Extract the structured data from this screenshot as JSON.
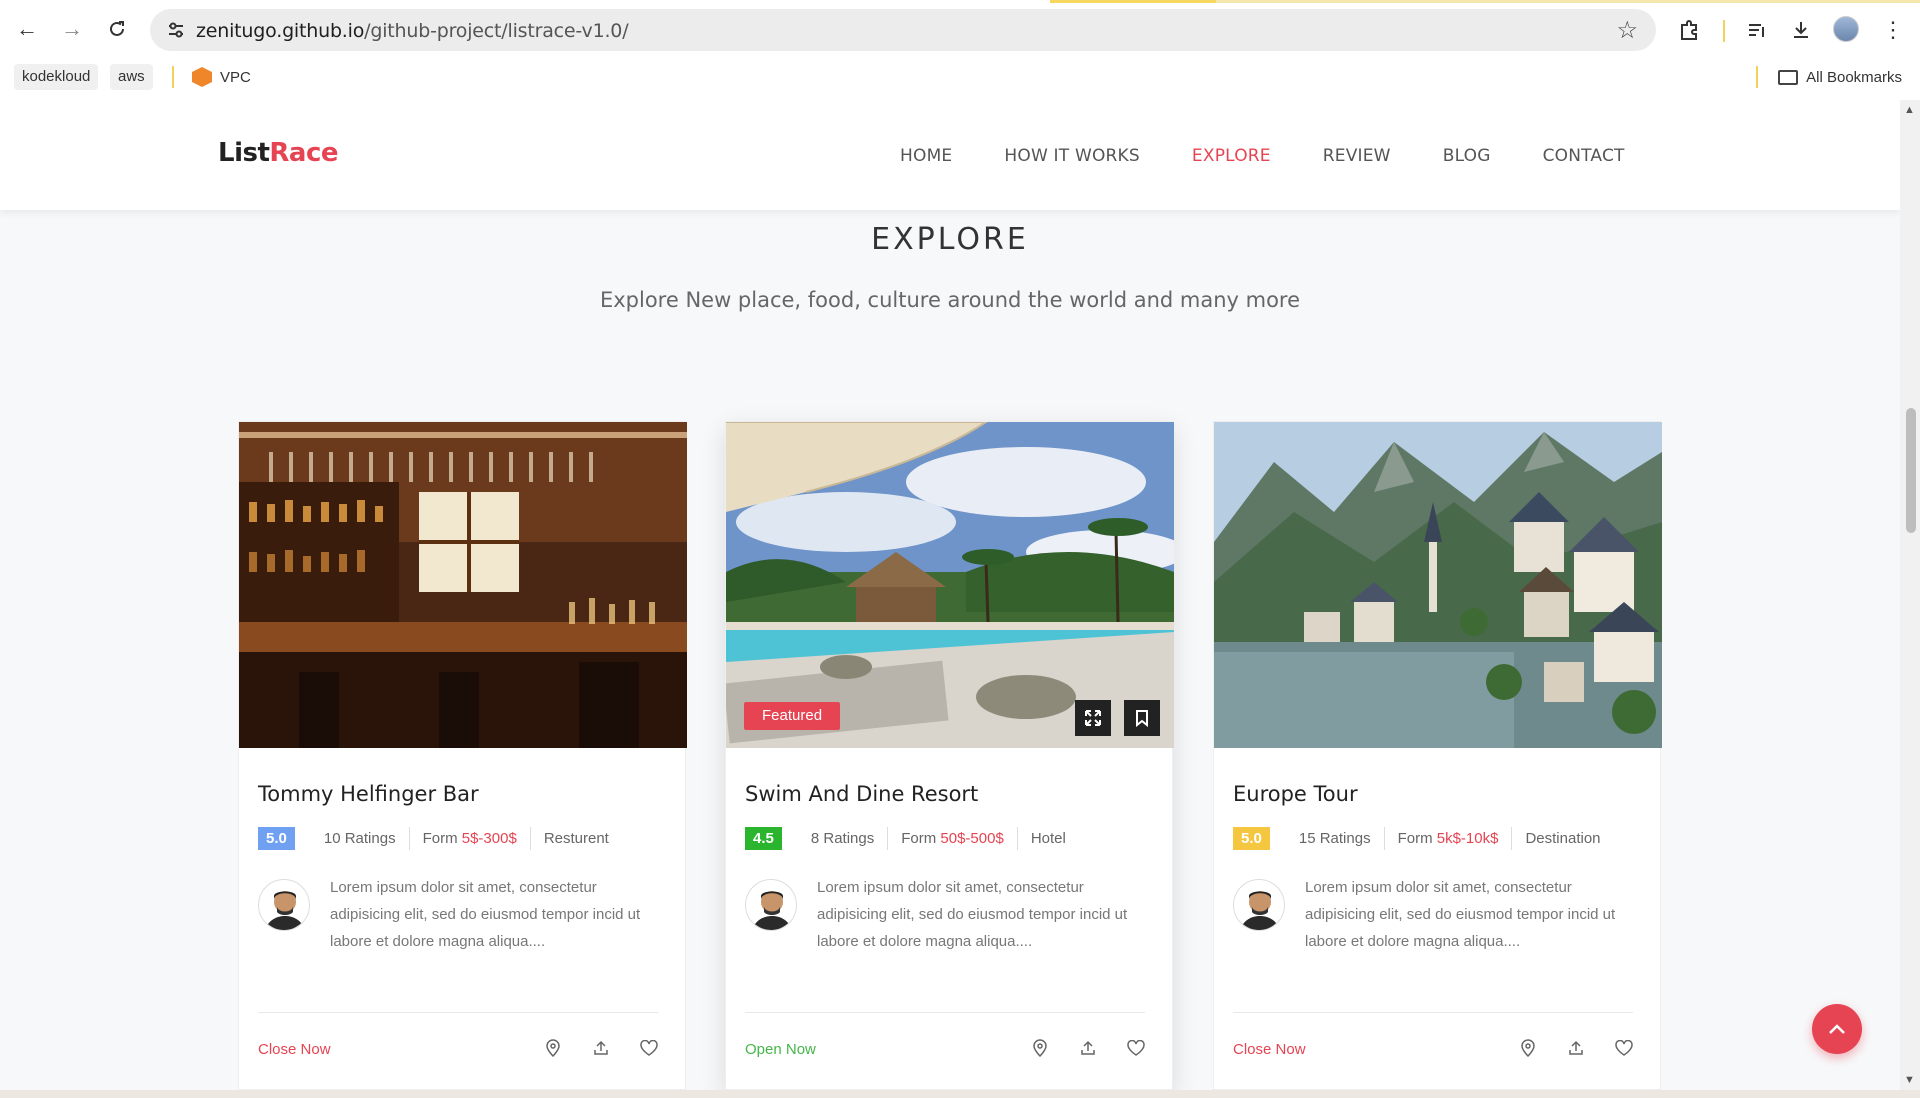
{
  "browser": {
    "url_host": "zenitugo.github.io",
    "url_path": "/github-project/listrace-v1.0/",
    "bookmarks": [
      "kodekloud",
      "aws"
    ],
    "bookmark_vpc": "VPC",
    "all_bookmarks": "All Bookmarks"
  },
  "site": {
    "logo_main": "List",
    "logo_accent": "Race",
    "menu": [
      "HOME",
      "HOW IT WORKS",
      "EXPLORE",
      "REVIEW",
      "BLOG",
      "CONTACT"
    ],
    "active_menu": "EXPLORE"
  },
  "section": {
    "title": "EXPLORE",
    "subtitle": "Explore New place, food, culture around the world and many more"
  },
  "cards": [
    {
      "title": "Tommy Helfinger Bar",
      "rating": "5.0",
      "ratings_count": "10 Ratings",
      "price_prefix": "Form",
      "price": "5$-300$",
      "category": "Resturent",
      "description": "Lorem ipsum dolor sit amet, consectetur adipisicing elit, sed do eiusmod tempor incid ut labore et dolore magna aliqua....",
      "status": "Close Now",
      "badge_color": "#6fa0f2",
      "status_color": "#e64452"
    },
    {
      "title": "Swim And Dine Resort",
      "rating": "4.5",
      "ratings_count": "8 Ratings",
      "price_prefix": "Form",
      "price": "50$-500$",
      "category": "Hotel",
      "description": "Lorem ipsum dolor sit amet, consectetur adipisicing elit, sed do eiusmod tempor incid ut labore et dolore magna aliqua....",
      "status": "Open Now",
      "featured": "Featured",
      "badge_color": "#2bb52f",
      "status_color": "#45b649"
    },
    {
      "title": "Europe Tour",
      "rating": "5.0",
      "ratings_count": "15 Ratings",
      "price_prefix": "Form",
      "price": "5k$-10k$",
      "category": "Destination",
      "description": "Lorem ipsum dolor sit amet, consectetur adipisicing elit, sed do eiusmod tempor incid ut labore et dolore magna aliqua....",
      "status": "Close Now",
      "badge_color": "#f5c640",
      "status_color": "#e64452"
    }
  ],
  "colors": {
    "accent": "#e64452"
  }
}
